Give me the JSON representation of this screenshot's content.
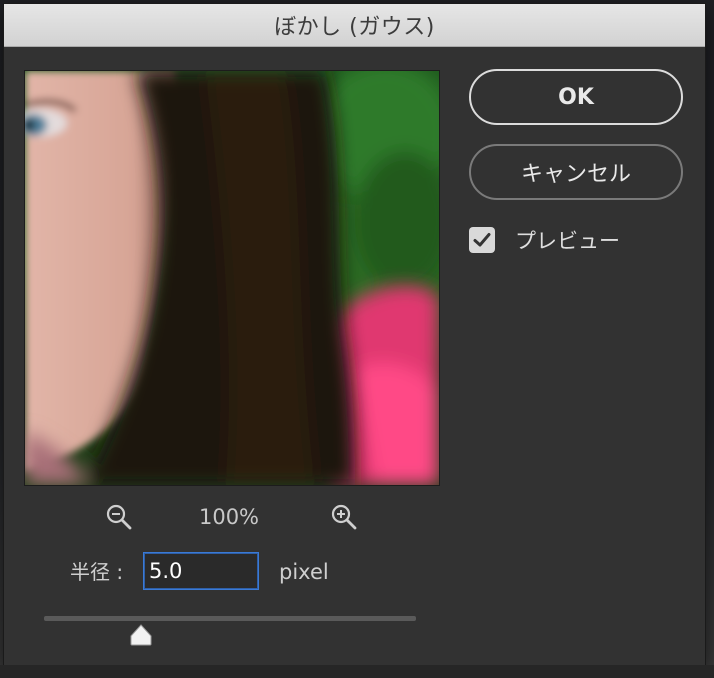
{
  "dialog": {
    "title": "ぼかし (ガウス)"
  },
  "buttons": {
    "ok_label": "OK",
    "cancel_label": "キャンセル"
  },
  "preview_option": {
    "label": "プレビュー",
    "checked": true
  },
  "zoom": {
    "level": "100%",
    "zoom_out_icon": "zoom-out-icon",
    "zoom_in_icon": "zoom-in-icon"
  },
  "radius": {
    "label": "半径 :",
    "value": "5.0",
    "unit": "pixel",
    "slider_fraction": 0.26
  },
  "colors": {
    "dialog_bg": "#323232",
    "accent": "#2a67c4"
  }
}
